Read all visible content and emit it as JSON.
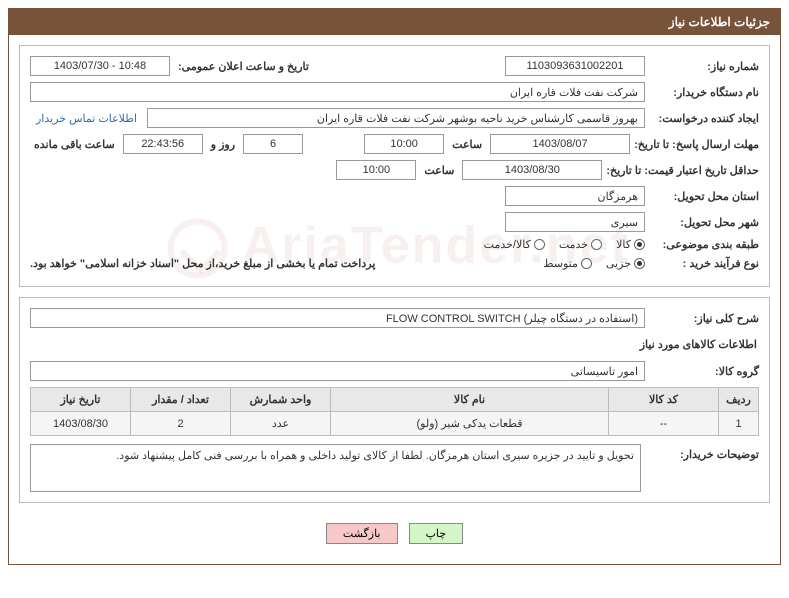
{
  "header_title": "جزئیات اطلاعات نیاز",
  "labels": {
    "need_no": "شماره نیاز:",
    "announce_dt": "تاریخ و ساعت اعلان عمومی:",
    "buyer_org": "نام دستگاه خریدار:",
    "requester": "ایجاد کننده درخواست:",
    "contact_link": "اطلاعات تماس خریدار",
    "reply_deadline": "مهلت ارسال پاسخ: تا تاریخ:",
    "time_lbl": "ساعت",
    "days_and": "روز و",
    "remaining": "ساعت باقی مانده",
    "price_validity": "حداقل تاریخ اعتبار قیمت: تا تاریخ:",
    "delivery_province": "استان محل تحویل:",
    "delivery_city": "شهر محل تحویل:",
    "subject_class": "طبقه بندی موضوعی:",
    "purchase_type": "نوع فرآیند خرید :",
    "treasury_note": "پرداخت تمام یا بخشی از مبلغ خرید،از محل \"اسناد خزانه اسلامی\" خواهد بود.",
    "overall_desc": "شرح کلی نیاز:",
    "goods_info_title": "اطلاعات کالاهای مورد نیاز",
    "goods_group": "گروه کالا:",
    "buyer_notes": "توضیحات خریدار:"
  },
  "fields": {
    "need_no": "1103093631002201",
    "announce_dt": "1403/07/30 - 10:48",
    "buyer_org": "شرکت نفت فلات قاره ایران",
    "requester": "بهروز قاسمی کارشناس خرید ناحیه بوشهر شرکت نفت فلات قاره ایران",
    "reply_date": "1403/08/07",
    "reply_time": "10:00",
    "days_remaining": "6",
    "countdown": "22:43:56",
    "validity_date": "1403/08/30",
    "validity_time": "10:00",
    "province": "هرمزگان",
    "city": "سیری",
    "overall_desc": "FLOW CONTROL SWITCH (استفاده در دستگاه چیلر)",
    "goods_group": "امور تاسیساتی",
    "buyer_notes": "تحویل و تایید در جزیره سیری استان هرمزگان. لطفا از کالای تولید داخلی و همراه با بررسی فنی کامل پیشنهاد شود."
  },
  "radios": {
    "subject": {
      "opt1": "کالا",
      "opt2": "خدمت",
      "opt3": "کالا/خدمت"
    },
    "purchase": {
      "opt1": "جزیی",
      "opt2": "متوسط"
    }
  },
  "table": {
    "headers": {
      "row": "ردیف",
      "code": "کد کالا",
      "name": "نام کالا",
      "unit": "واحد شمارش",
      "qty": "تعداد / مقدار",
      "date": "تاریخ نیاز"
    },
    "rows": [
      {
        "row": "1",
        "code": "--",
        "name": "قطعات یدکی شیر (ولو)",
        "unit": "عدد",
        "qty": "2",
        "date": "1403/08/30"
      }
    ]
  },
  "buttons": {
    "print": "چاپ",
    "back": "بازگشت"
  },
  "watermark": "AriaTender.net"
}
